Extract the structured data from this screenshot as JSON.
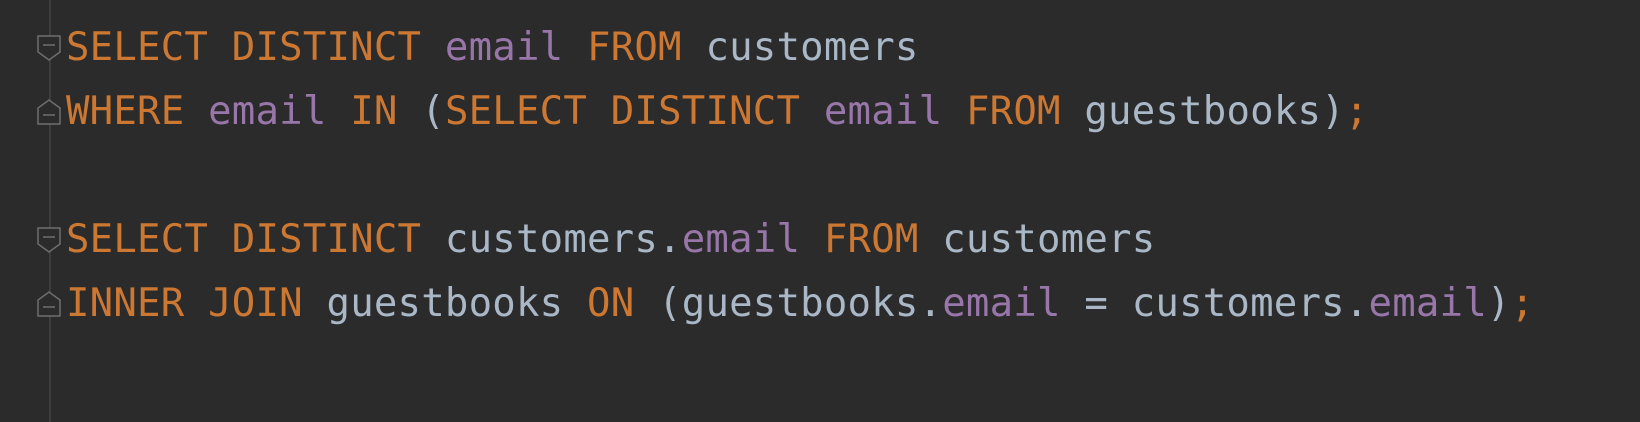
{
  "editor": {
    "language": "SQL",
    "colors": {
      "background": "#2b2b2b",
      "keyword": "#cc7832",
      "column": "#9876aa",
      "identifier": "#a9b7c6"
    },
    "lines": [
      {
        "fold": "fold-start-icon",
        "tokens": [
          {
            "t": "SELECT",
            "k": "kw"
          },
          {
            "t": " ",
            "k": "pu"
          },
          {
            "t": "DISTINCT",
            "k": "kw"
          },
          {
            "t": " ",
            "k": "pu"
          },
          {
            "t": "email",
            "k": "col"
          },
          {
            "t": " ",
            "k": "pu"
          },
          {
            "t": "FROM",
            "k": "kw"
          },
          {
            "t": " ",
            "k": "pu"
          },
          {
            "t": "customers",
            "k": "id"
          }
        ]
      },
      {
        "fold": "fold-end-icon",
        "tokens": [
          {
            "t": "WHERE",
            "k": "kw"
          },
          {
            "t": " ",
            "k": "pu"
          },
          {
            "t": "email",
            "k": "col"
          },
          {
            "t": " ",
            "k": "pu"
          },
          {
            "t": "IN",
            "k": "kw"
          },
          {
            "t": " ",
            "k": "pu"
          },
          {
            "t": "(",
            "k": "pu"
          },
          {
            "t": "SELECT",
            "k": "kw"
          },
          {
            "t": " ",
            "k": "pu"
          },
          {
            "t": "DISTINCT",
            "k": "kw"
          },
          {
            "t": " ",
            "k": "pu"
          },
          {
            "t": "email",
            "k": "col"
          },
          {
            "t": " ",
            "k": "pu"
          },
          {
            "t": "FROM",
            "k": "kw"
          },
          {
            "t": " ",
            "k": "pu"
          },
          {
            "t": "guestbooks",
            "k": "id"
          },
          {
            "t": ")",
            "k": "pu"
          },
          {
            "t": ";",
            "k": "semi"
          }
        ]
      },
      {
        "fold": "",
        "tokens": []
      },
      {
        "fold": "fold-start-icon",
        "tokens": [
          {
            "t": "SELECT",
            "k": "kw"
          },
          {
            "t": " ",
            "k": "pu"
          },
          {
            "t": "DISTINCT",
            "k": "kw"
          },
          {
            "t": " ",
            "k": "pu"
          },
          {
            "t": "customers.",
            "k": "id"
          },
          {
            "t": "email",
            "k": "col"
          },
          {
            "t": " ",
            "k": "pu"
          },
          {
            "t": "FROM",
            "k": "kw"
          },
          {
            "t": " ",
            "k": "pu"
          },
          {
            "t": "customers",
            "k": "id"
          }
        ]
      },
      {
        "fold": "fold-end-icon",
        "tokens": [
          {
            "t": "INNER",
            "k": "kw"
          },
          {
            "t": " ",
            "k": "pu"
          },
          {
            "t": "JOIN",
            "k": "kw"
          },
          {
            "t": " ",
            "k": "pu"
          },
          {
            "t": "guestbooks",
            "k": "id"
          },
          {
            "t": " ",
            "k": "pu"
          },
          {
            "t": "ON",
            "k": "kw"
          },
          {
            "t": " ",
            "k": "pu"
          },
          {
            "t": "(",
            "k": "pu"
          },
          {
            "t": "guestbooks.",
            "k": "id"
          },
          {
            "t": "email",
            "k": "col"
          },
          {
            "t": " = ",
            "k": "pu"
          },
          {
            "t": "customers.",
            "k": "id"
          },
          {
            "t": "email",
            "k": "col"
          },
          {
            "t": ")",
            "k": "pu"
          },
          {
            "t": ";",
            "k": "semi"
          }
        ]
      }
    ]
  }
}
